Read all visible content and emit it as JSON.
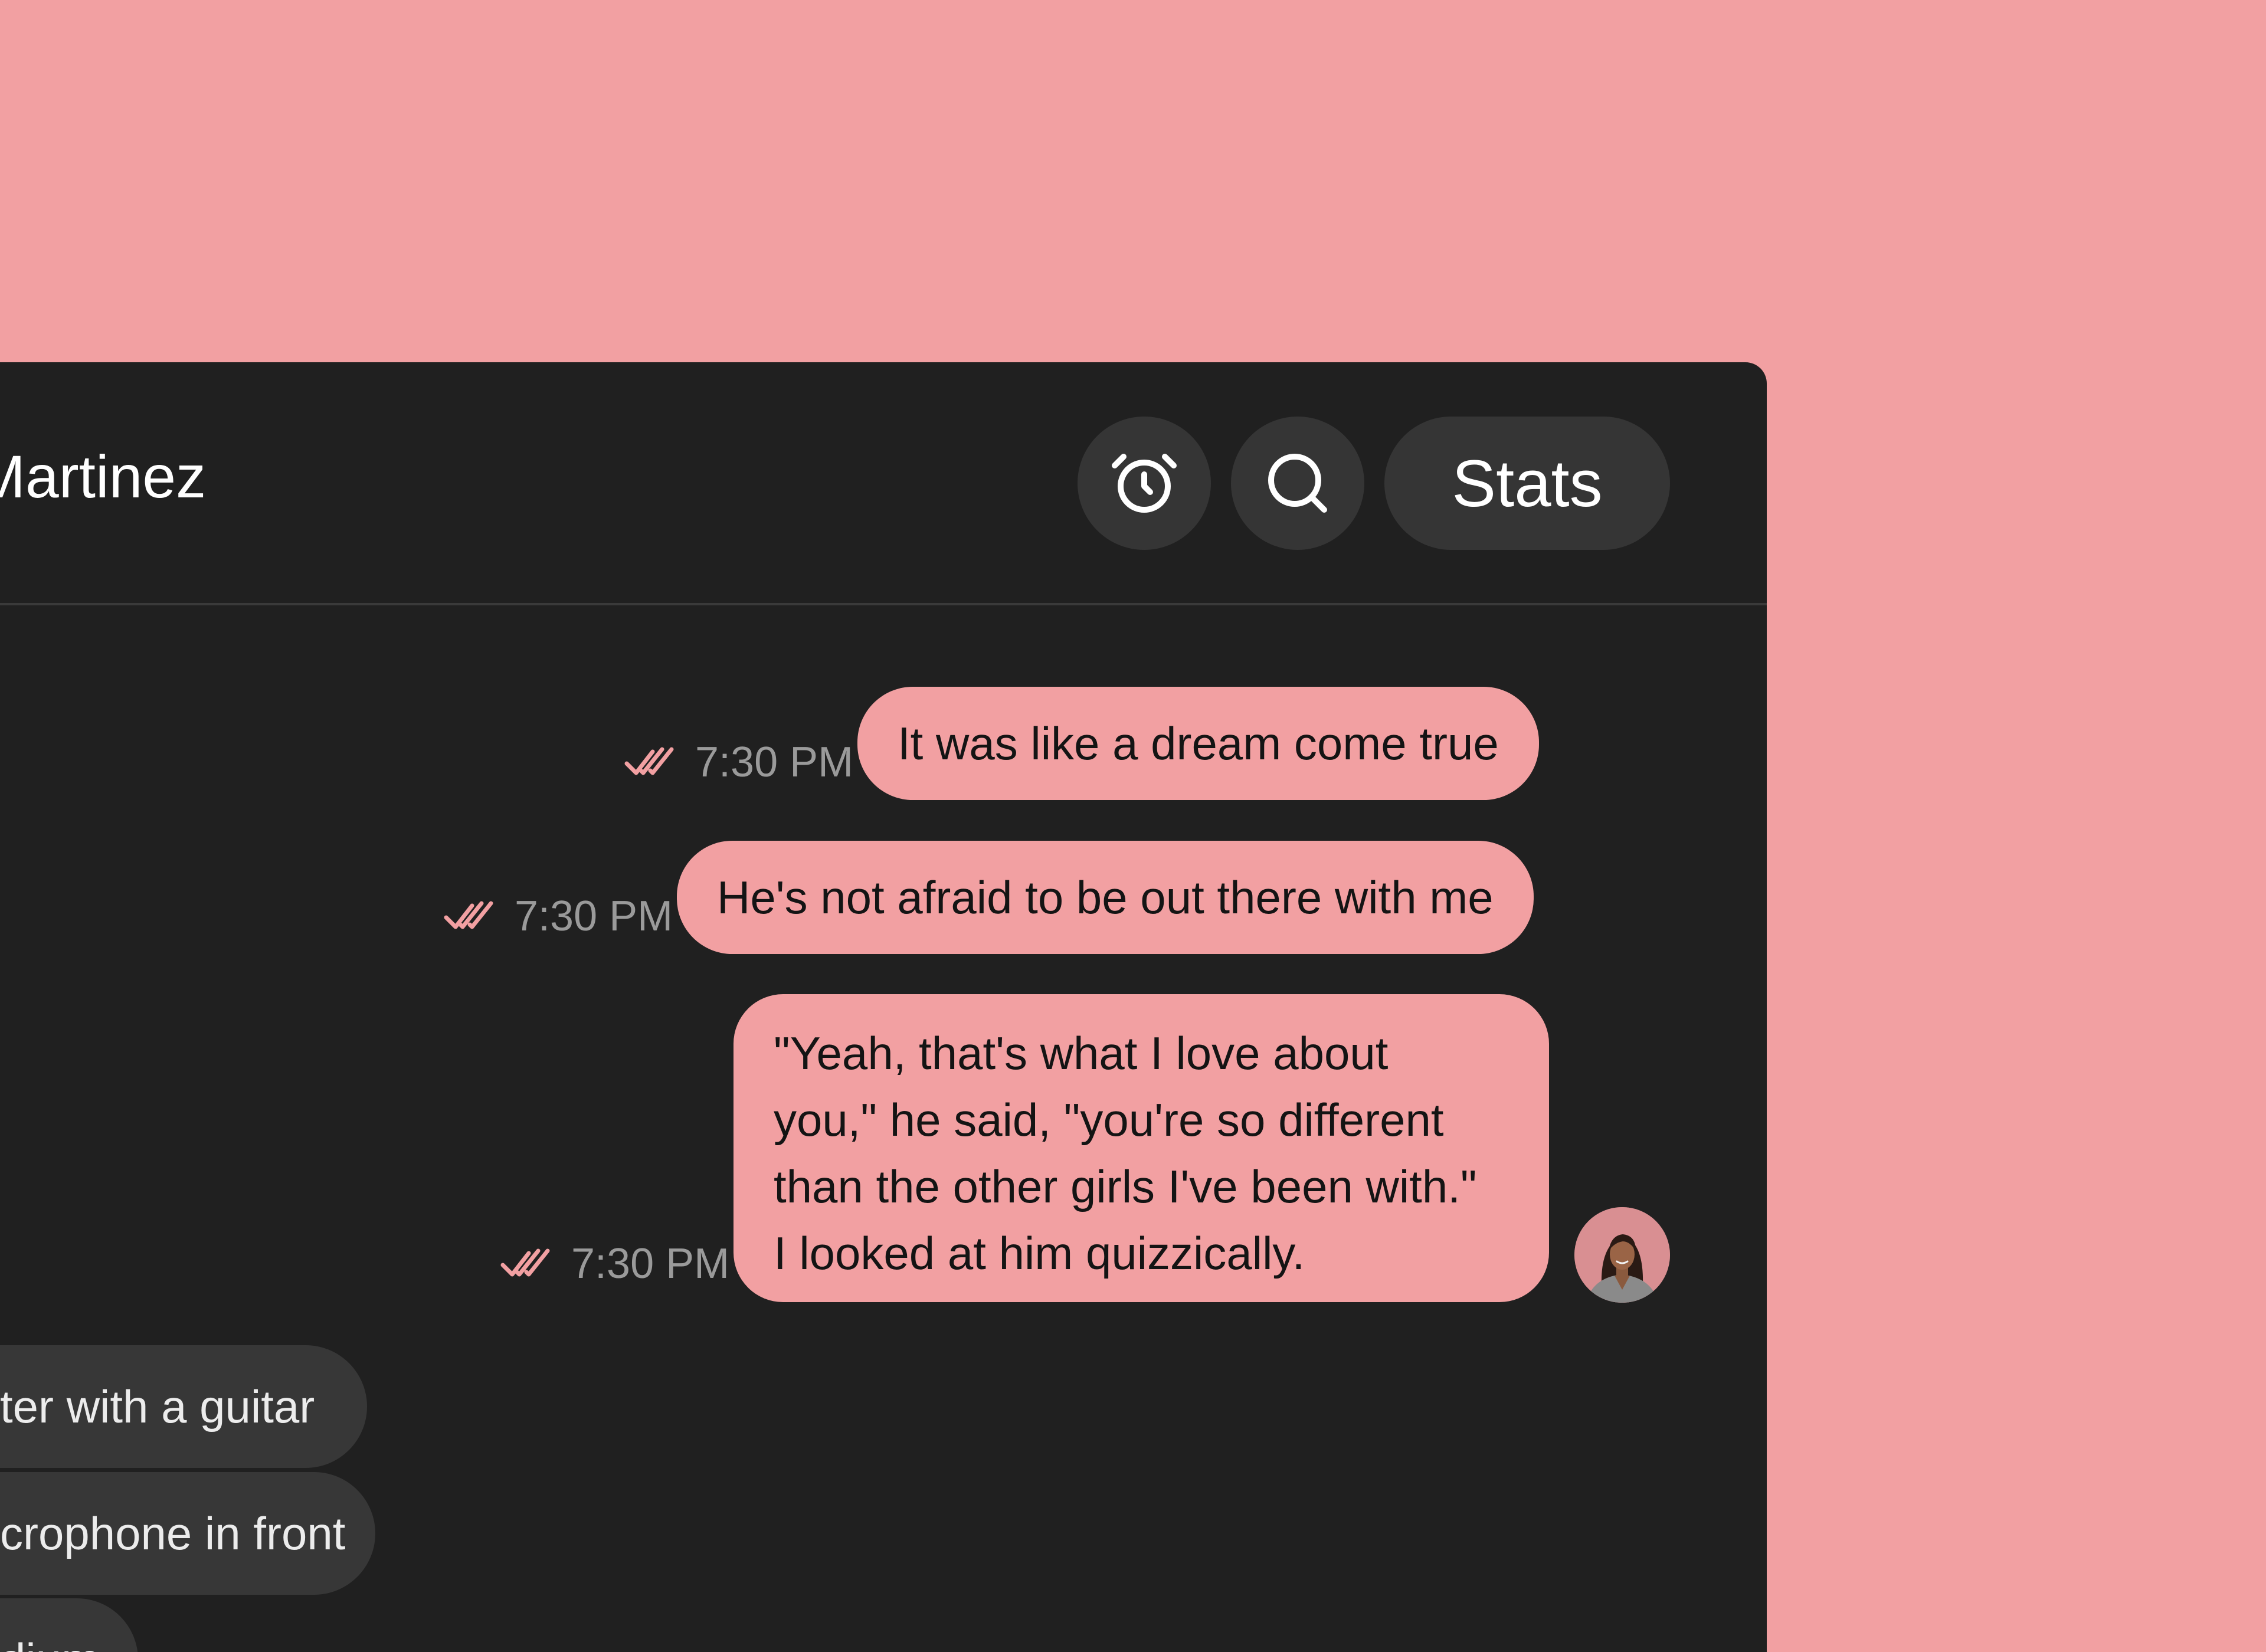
{
  "header": {
    "contact_name": "Martinez",
    "stats_label": "Stats",
    "icons": [
      "alarm-clock-icon",
      "search-icon"
    ]
  },
  "messages": {
    "outgoing": [
      {
        "text": "It was like a dream come true",
        "time": "7:30 PM",
        "status": "read"
      },
      {
        "text": "He's not afraid to be out there with me",
        "time": "7:30 PM",
        "status": "read"
      },
      {
        "lines": [
          "\"Yeah, that's what I love about",
          "you,\" he said, \"you're so different",
          "than the other girls I've been with.\"",
          "I looked at him quizzically."
        ],
        "time": "7:30 PM",
        "status": "read"
      }
    ],
    "incoming": [
      {
        "text": "ter with a guitar"
      },
      {
        "text": "crophone in front"
      },
      {
        "text": "dium"
      }
    ]
  },
  "colors": {
    "accent": "#f2a0a2",
    "window_bg": "#202020",
    "control_bg": "#353535",
    "incoming_bubble": "#373737"
  }
}
